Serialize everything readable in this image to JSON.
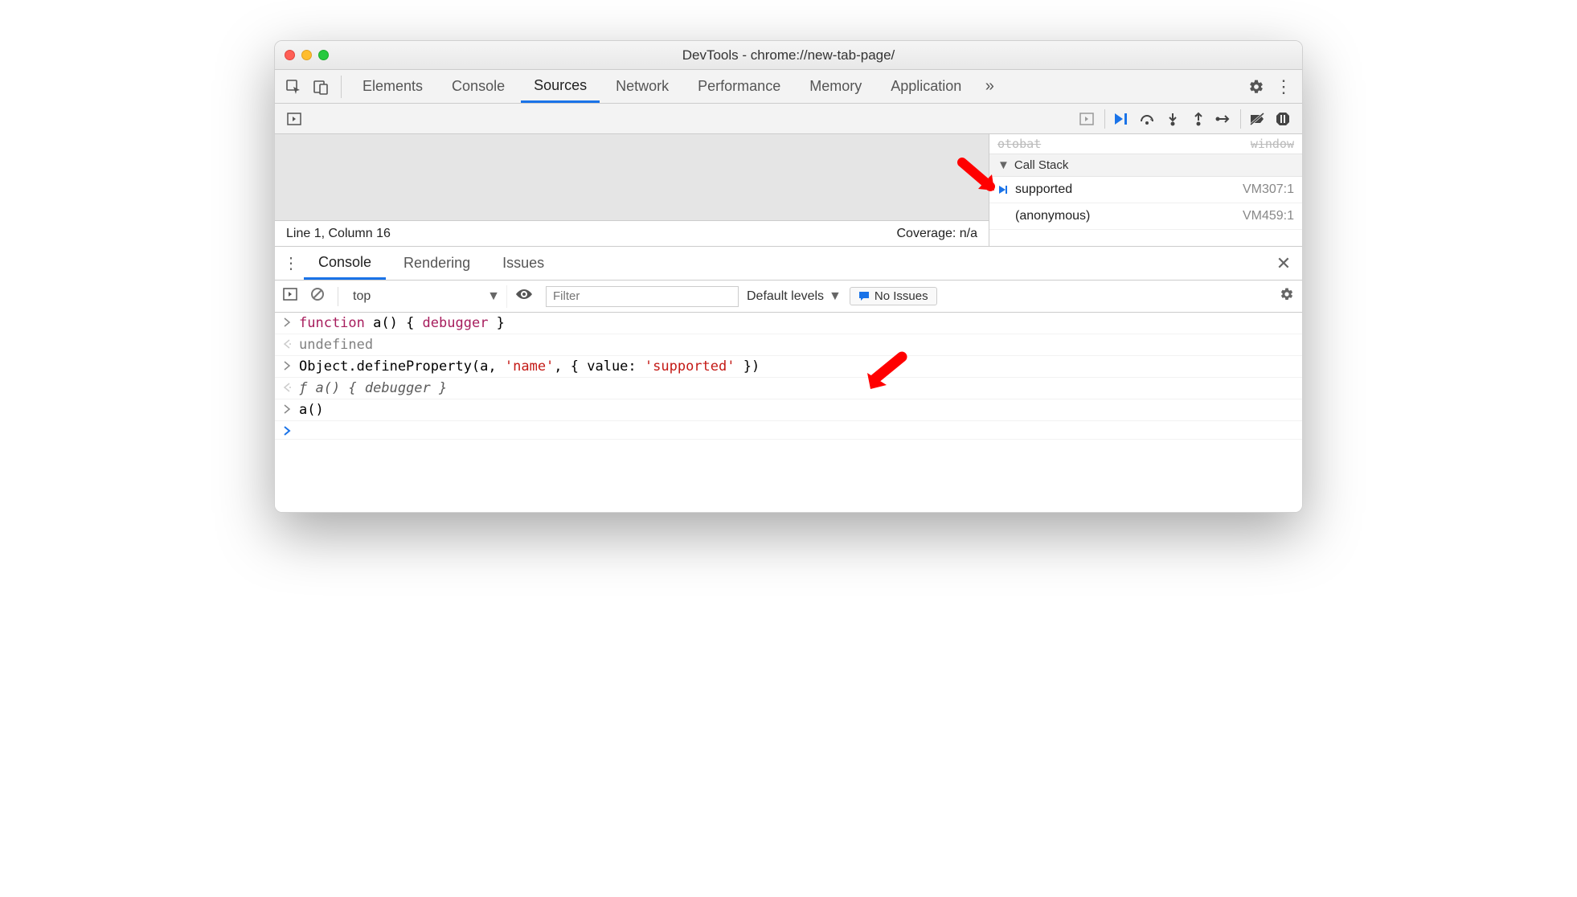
{
  "title": "DevTools - chrome://new-tab-page/",
  "tabs": {
    "elements": "Elements",
    "console": "Console",
    "sources": "Sources",
    "network": "Network",
    "performance": "Performance",
    "memory": "Memory",
    "application": "Application"
  },
  "sources": {
    "cursor_status": "Line 1, Column 16",
    "coverage": "Coverage: n/a"
  },
  "callstack": {
    "header": "Call Stack",
    "truncated_left": "otobat",
    "truncated_right": "window",
    "frames": [
      {
        "name": "supported",
        "location": "VM307:1",
        "current": true
      },
      {
        "name": "(anonymous)",
        "location": "VM459:1",
        "current": false
      }
    ]
  },
  "drawer": {
    "tabs": {
      "console": "Console",
      "rendering": "Rendering",
      "issues": "Issues"
    }
  },
  "console_toolbar": {
    "context": "top",
    "filter_placeholder": "Filter",
    "levels": "Default levels",
    "issues_chip": "No Issues"
  },
  "console_lines": {
    "l1_kw_function": "function",
    "l1_rest": " a() { ",
    "l1_kw_debugger": "debugger",
    "l1_end": " }",
    "l2": "undefined",
    "l3_pre": "Object.defineProperty(a, ",
    "l3_str1": "'name'",
    "l3_mid": ", { value: ",
    "l3_str2": "'supported'",
    "l3_end": " })",
    "l4_f": "ƒ ",
    "l4_rest": "a() { debugger }",
    "l5": "a()"
  }
}
